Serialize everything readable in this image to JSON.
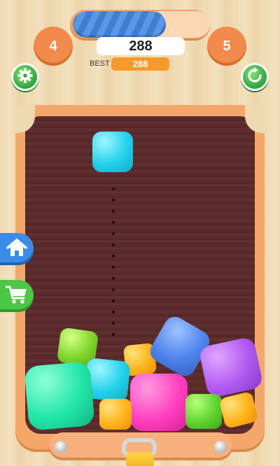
{
  "hud": {
    "current_level": "4",
    "next_level": "5",
    "level_progress": 0.68,
    "score": "288",
    "best_label": "BEST",
    "best_score": "288"
  },
  "icons": {
    "settings": "gear-icon",
    "restart": "restart-icon",
    "home": "home-icon",
    "shop": "cart-icon"
  },
  "colors": {
    "frame": "#f5a76a",
    "board": "#5a2b2a",
    "progress": "#3f7fd1",
    "level_circle": "#f28a4b",
    "best_badge": "#f79a2c",
    "green_button": "#2fa63a",
    "home_tab": "#3b8ce8",
    "shop_tab": "#4cc646"
  },
  "board": {
    "next_block": {
      "color": "cyan"
    },
    "blocks": [
      {
        "color": "lime"
      },
      {
        "color": "mint"
      },
      {
        "color": "cyan"
      },
      {
        "color": "orange"
      },
      {
        "color": "blue"
      },
      {
        "color": "purple"
      },
      {
        "color": "pink"
      },
      {
        "color": "orange"
      },
      {
        "color": "green"
      },
      {
        "color": "orange"
      }
    ]
  }
}
